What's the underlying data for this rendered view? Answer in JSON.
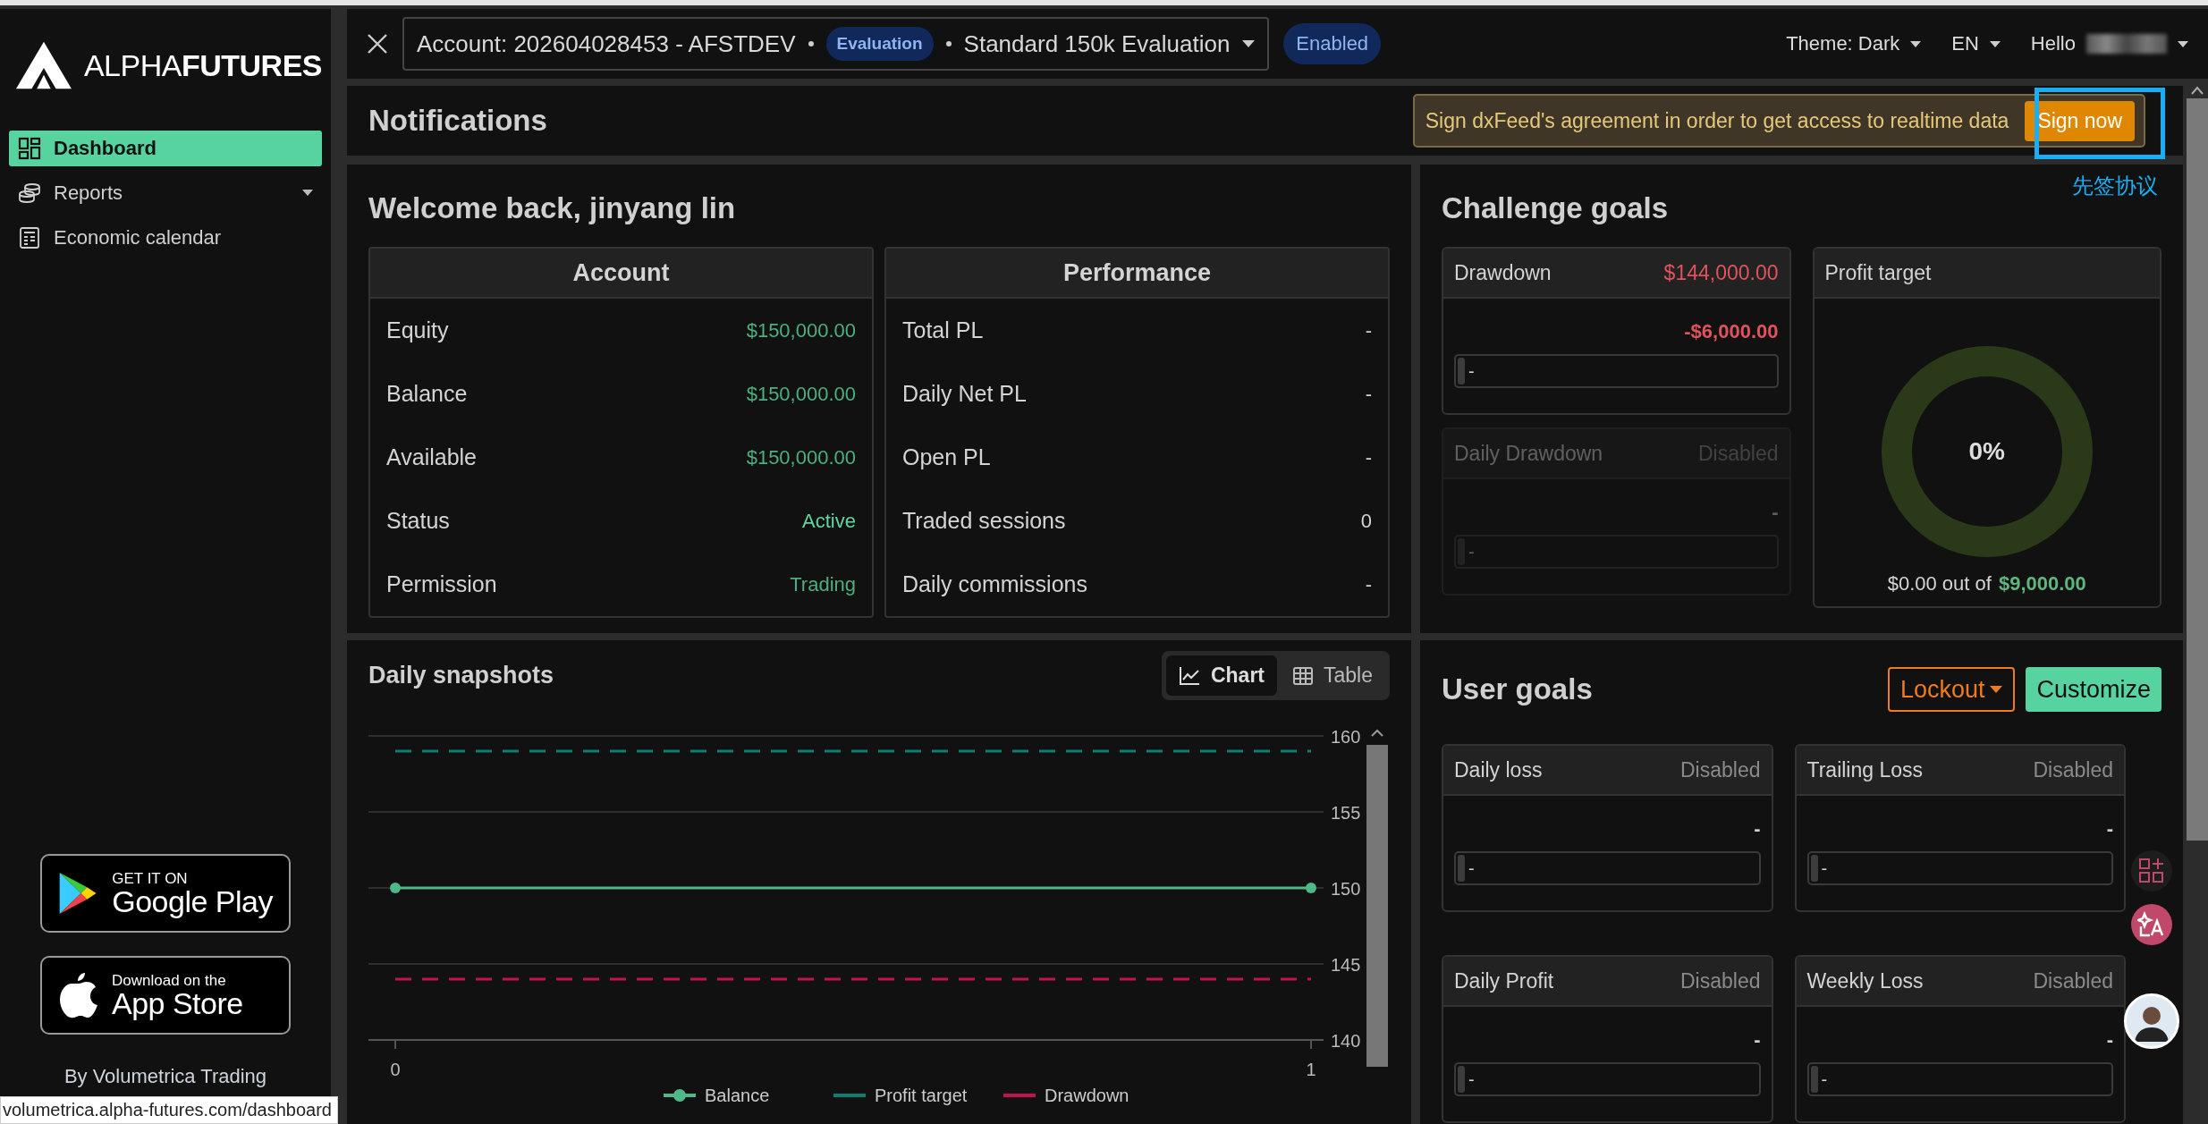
{
  "sidebar": {
    "logo": {
      "light": "ALPHA",
      "bold": "FUTURES"
    },
    "items": [
      {
        "label": "Dashboard",
        "selected": true,
        "has_caret": false
      },
      {
        "label": "Reports",
        "selected": false,
        "has_caret": true
      },
      {
        "label": "Economic calendar",
        "selected": false,
        "has_caret": false
      }
    ],
    "store_badges": [
      {
        "kind": "google-play",
        "small": "GET IT ON",
        "big": "Google Play"
      },
      {
        "kind": "app-store",
        "small": "Download on the",
        "big": "App Store"
      }
    ],
    "credit": "By Volumetrica Trading"
  },
  "status_url": "volumetrica.alpha-futures.com/dashboard",
  "top_bar": {
    "account": "Account: 202604028453 - AFSTDEV",
    "account_type": "Evaluation",
    "plan": "Standard 150k Evaluation",
    "status": "Enabled",
    "menus": [
      "Theme: Dark",
      "EN",
      "Hello"
    ]
  },
  "notifications": {
    "title": "Notifications",
    "message": "Sign dxFeed's agreement in order to get access to realtime data",
    "action": "Sign now",
    "annotation": "先签协议"
  },
  "welcome": {
    "title": "Welcome back, jinyang lin",
    "tables": [
      {
        "title": "Account",
        "rows": [
          {
            "label": "Equity",
            "value": "$150,000.00",
            "color": "#4caf7d"
          },
          {
            "label": "Balance",
            "value": "$150,000.00",
            "color": "#4caf7d"
          },
          {
            "label": "Available",
            "value": "$150,000.00",
            "color": "#4caf7d"
          },
          {
            "label": "Status",
            "value": "Active",
            "color": "#5fd6a0"
          },
          {
            "label": "Permission",
            "value": "Trading",
            "color": "#4caf7d"
          }
        ]
      },
      {
        "title": "Performance",
        "rows": [
          {
            "label": "Total PL",
            "value": "-"
          },
          {
            "label": "Daily Net PL",
            "value": "-"
          },
          {
            "label": "Open PL",
            "value": "-"
          },
          {
            "label": "Traded sessions",
            "value": "0"
          },
          {
            "label": "Daily commissions",
            "value": "-"
          }
        ]
      }
    ]
  },
  "challenge_goals": {
    "title": "Challenge goals",
    "goals": [
      {
        "name": "Drawdown",
        "kind": "active",
        "status": "$144,000.00",
        "value": "-$6,000.00",
        "bar_text": "-",
        "level": 0,
        "greyed": false
      },
      {
        "name": "Daily Drawdown",
        "kind": "disabled",
        "status": "Disabled",
        "value": "-",
        "bar_text": "-",
        "level": 0,
        "greyed": true
      }
    ],
    "profit_target": {
      "title": "Profit target",
      "percent": "0%",
      "level": 0,
      "current": "$0.00 out of",
      "target": "$9,000.00"
    }
  },
  "snapshots": {
    "title": "Daily snapshots",
    "views": [
      {
        "label": "Chart",
        "selected": true
      },
      {
        "label": "Table",
        "selected": false
      }
    ],
    "chart_data": {
      "type": "line",
      "x": [
        0,
        1
      ],
      "xlim": [
        0,
        1
      ],
      "xticks": [
        0,
        1
      ],
      "ylim": [
        140,
        160
      ],
      "yticks": [
        140,
        145,
        150,
        155,
        160
      ],
      "grid": true,
      "legend": true,
      "series": [
        {
          "name": "Balance",
          "color": "#4fb888",
          "values": [
            150,
            150
          ],
          "marker": "circle",
          "line_style": "solid"
        },
        {
          "name": "Profit target",
          "color": "#0c7f71",
          "values": [
            159,
            159
          ],
          "line_style": "dashed"
        },
        {
          "name": "Drawdown",
          "color": "#c4134a",
          "values": [
            144,
            144
          ],
          "line_style": "dashed"
        }
      ]
    }
  },
  "user_goals": {
    "title": "User goals",
    "lockout": "Lockout",
    "customize": "Customize",
    "goals": [
      {
        "name": "Daily loss",
        "kind": "disabled",
        "status": "Disabled",
        "value": "-",
        "bar_text": "-",
        "level": 0,
        "greyed": false
      },
      {
        "name": "Trailing Loss",
        "kind": "disabled",
        "status": "Disabled",
        "value": "-",
        "bar_text": "-",
        "level": 0,
        "greyed": false
      },
      {
        "name": "Daily Profit",
        "kind": "disabled",
        "status": "Disabled",
        "value": "-",
        "bar_text": "-",
        "level": 0,
        "greyed": false
      },
      {
        "name": "Weekly Loss",
        "kind": "disabled",
        "status": "Disabled",
        "value": "-",
        "bar_text": "-",
        "level": 0,
        "greyed": false
      }
    ]
  }
}
